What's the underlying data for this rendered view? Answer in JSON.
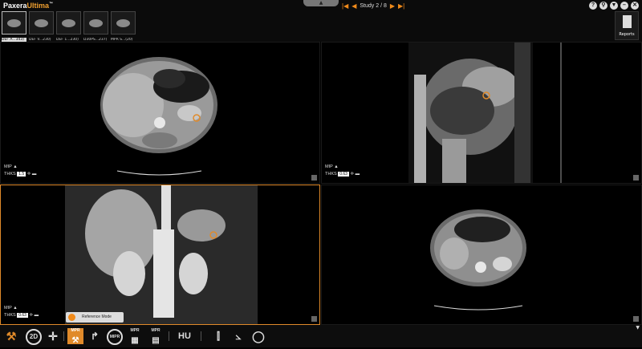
{
  "app": {
    "logo_a": "Paxera",
    "logo_b": "Ultima",
    "logo_tm": "™"
  },
  "study": {
    "label": "Study 2 / 8"
  },
  "top_icons": [
    "help-icon",
    "search-icon",
    "settings-icon",
    "minimize-icon",
    "close-icon"
  ],
  "top_icon_glyphs": [
    "?",
    "⚲",
    "▼",
    "–",
    "✕"
  ],
  "series": [
    {
      "label": "DEF A...343)"
    },
    {
      "label": "DEF V...230)"
    },
    {
      "label": "DEF 1...230)"
    },
    {
      "label": "D30PS...237)"
    },
    {
      "label": "MPR S...(20)"
    }
  ],
  "reports": {
    "label": "Reports"
  },
  "viewports": [
    {
      "mode": "MIP",
      "thick_label": "THKS",
      "thick_value": "1.5"
    },
    {
      "mode": "MIP",
      "thick_label": "THKS",
      "thick_value": "0.63"
    },
    {
      "mode": "MIP",
      "thick_label": "THKS",
      "thick_value": "0.63"
    }
  ],
  "tooltip": {
    "label": "Reference Mode"
  },
  "toolbar": {
    "two_d": "2D",
    "mpr1": "MPR",
    "mpr2": "MPR",
    "mpr3": "MPR",
    "hu": "HU",
    "circle_tool": "MIPR"
  },
  "colors": {
    "accent": "#e08a2a",
    "nav": "#f08a1a"
  }
}
